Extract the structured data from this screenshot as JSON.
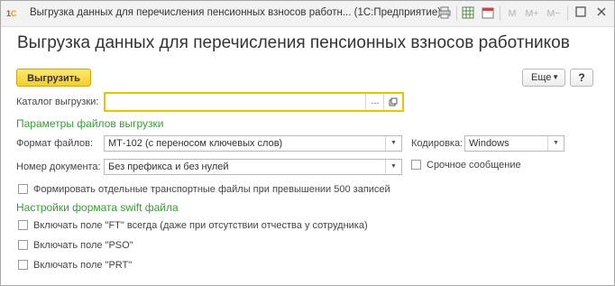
{
  "window": {
    "title": "Выгрузка данных для перечисления пенсионных взносов работн...  (1С:Предприятие)",
    "toolbar": {
      "memory": "M",
      "memory_plus": "M+",
      "memory_minus": "M−",
      "calendar_day": "31"
    }
  },
  "form": {
    "title": "Выгрузка данных для перечисления пенсионных взносов работников",
    "export_button": "Выгрузить",
    "more_button": "Еще",
    "help_button": "?"
  },
  "catalog": {
    "label": "Каталог выгрузки:",
    "value": "",
    "select_button": "..."
  },
  "file_params": {
    "header": "Параметры файлов выгрузки",
    "format_label": "Формат файлов:",
    "format_value": "МТ-102 (с переносом ключевых слов)",
    "encoding_label": "Кодировка:",
    "encoding_value": "Windows",
    "doc_number_label": "Номер документа:",
    "doc_number_value": "Без префикса и без нулей",
    "urgent_label": "Срочное сообщение",
    "separate_files_label": "Формировать отдельные транспортные файлы при превышении 500 записей"
  },
  "swift": {
    "header": "Настройки формата swift файла",
    "ft_label": "Включать поле \"FT\" всегда (даже при отсутствии отчества у сотрудника)",
    "pso_label": "Включать поле \"PSO\"",
    "prt_label": "Включать поле \"PRT\""
  },
  "colors": {
    "accent": "#f4cf2a",
    "section_header": "#3a9a3a"
  }
}
